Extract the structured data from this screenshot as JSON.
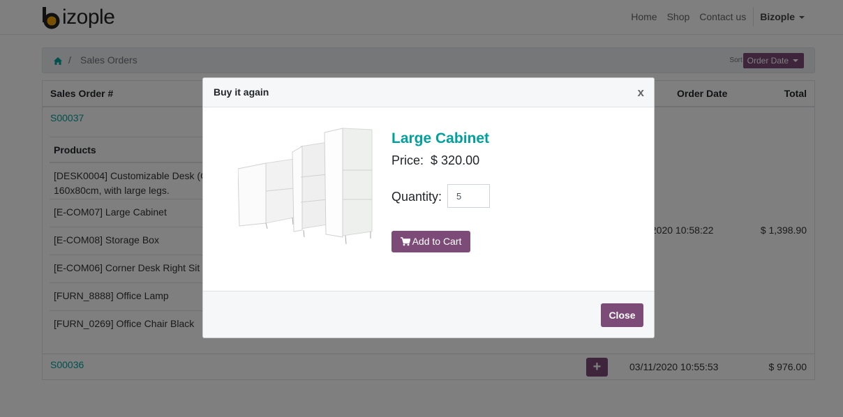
{
  "brand": {
    "logo_text": "izople"
  },
  "nav": {
    "links": [
      "Home",
      "Shop",
      "Contact us"
    ],
    "user": "Bizople"
  },
  "breadcrumb": {
    "separator": "/",
    "current": "Sales Orders",
    "sort_label": "Sort By:",
    "sort_value": "Order Date"
  },
  "table": {
    "headers": {
      "order": "Sales Order #",
      "date": "Order Date",
      "total": "Total"
    },
    "orders": [
      {
        "number": "S00037",
        "date_visible": "/2020  10:58:22",
        "total": "$ 1,398.90",
        "products_header": "Products",
        "products": [
          "[DESK0004] Customizable Desk (C",
          "160x80cm, with large legs.",
          "[E-COM07] Large Cabinet",
          "[E-COM08] Storage Box",
          "[E-COM06] Corner Desk Right Sit",
          "[FURN_8888] Office Lamp",
          "[FURN_0269] Office Chair Black"
        ]
      },
      {
        "number": "S00036",
        "action": "+",
        "date": "03/11/2020  10:55:53",
        "total": "$ 976.00"
      }
    ]
  },
  "modal": {
    "title": "Buy it again",
    "close_x": "x",
    "product_name": "Large Cabinet",
    "price_label": "Price:",
    "price": "$ 320.00",
    "quantity_label": "Quantity:",
    "quantity": "5",
    "add_to_cart": "Add to Cart",
    "close": "Close"
  },
  "colors": {
    "brand_purple": "#7c4b78",
    "teal": "#00A09D",
    "logo_orange": "#f0a500"
  },
  "icons": [
    "home-icon",
    "cart-icon",
    "caret-down-icon",
    "plus-icon",
    "close-icon"
  ]
}
